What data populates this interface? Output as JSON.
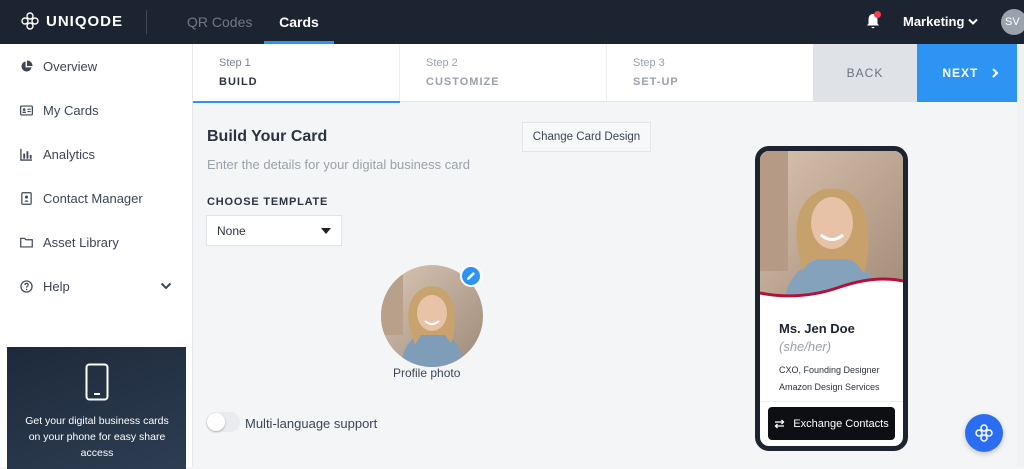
{
  "nav": {
    "brand": "UNIQODE",
    "tabs": [
      {
        "label": "QR Codes",
        "active": false
      },
      {
        "label": "Cards",
        "active": true
      }
    ],
    "workspace": "Marketing",
    "avatar_initials": "SV"
  },
  "sidebar": {
    "items": [
      {
        "label": "Overview",
        "icon": "pie-chart-icon"
      },
      {
        "label": "My Cards",
        "icon": "id-card-icon"
      },
      {
        "label": "Analytics",
        "icon": "bar-chart-icon"
      },
      {
        "label": "Contact Manager",
        "icon": "contact-book-icon"
      },
      {
        "label": "Asset Library",
        "icon": "folder-icon"
      },
      {
        "label": "Help",
        "icon": "question-icon"
      }
    ],
    "promo_text": "Get your digital business cards on your phone for easy share access"
  },
  "stepper": {
    "steps": [
      {
        "num": "Step 1",
        "name": "BUILD",
        "active": true
      },
      {
        "num": "Step 2",
        "name": "CUSTOMIZE",
        "active": false
      },
      {
        "num": "Step 3",
        "name": "SET-UP",
        "active": false
      }
    ],
    "back_label": "BACK",
    "next_label": "NEXT"
  },
  "main": {
    "title": "Build Your Card",
    "subtitle": "Enter the details for your digital business card",
    "change_design_label": "Change Card Design",
    "template_label": "CHOOSE TEMPLATE",
    "template_value": "None",
    "profile_label": "Profile photo",
    "multilang_label": "Multi-language support",
    "multilang_enabled": false
  },
  "preview": {
    "name": "Ms. Jen Doe",
    "pronouns": "(she/her)",
    "role": "CXO, Founding Designer",
    "company": "Amazon Design Services",
    "exchange_label": "Exchange Contacts"
  },
  "colors": {
    "accent": "#2d94f3",
    "nav_bg": "#1b2430",
    "card_wave": "#b0123a"
  }
}
